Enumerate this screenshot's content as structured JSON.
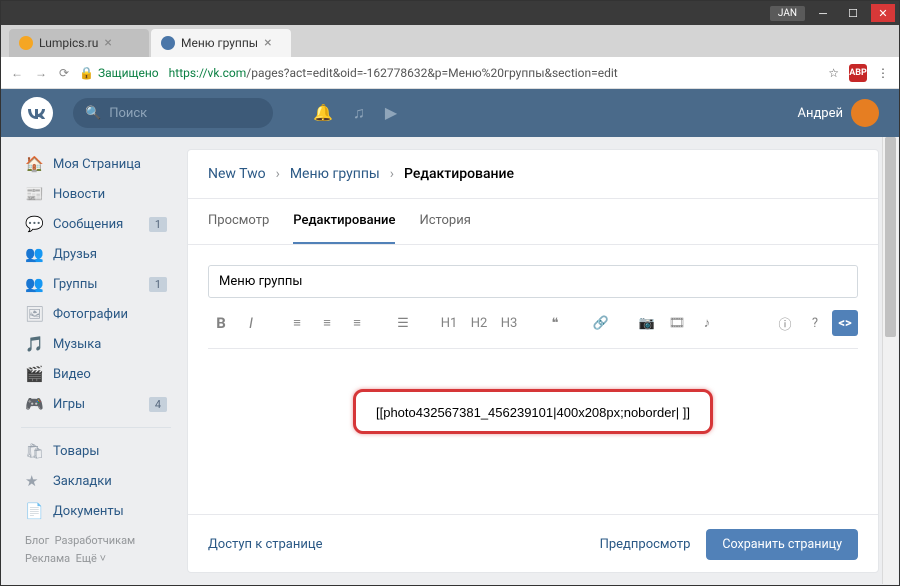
{
  "window": {
    "user": "JAN"
  },
  "tabs": [
    {
      "title": "Lumpics.ru"
    },
    {
      "title": "Меню группы"
    }
  ],
  "address": {
    "secure": "Защищено",
    "host": "https://vk.com",
    "path": "/pages?act=edit&oid=-162778632&p=Меню%20группы&section=edit"
  },
  "header": {
    "search_placeholder": "Поиск",
    "username": "Андрей"
  },
  "sidebar": {
    "items": [
      {
        "icon": "🏠",
        "label": "Моя Страница"
      },
      {
        "icon": "📰",
        "label": "Новости"
      },
      {
        "icon": "💬",
        "label": "Сообщения",
        "badge": "1"
      },
      {
        "icon": "👥",
        "label": "Друзья"
      },
      {
        "icon": "👥",
        "label": "Группы",
        "badge": "1"
      },
      {
        "icon": "🖼",
        "label": "Фотографии"
      },
      {
        "icon": "🎵",
        "label": "Музыка"
      },
      {
        "icon": "🎬",
        "label": "Видео"
      },
      {
        "icon": "🎮",
        "label": "Игры",
        "badge": "4"
      }
    ],
    "items2": [
      {
        "icon": "🛍",
        "label": "Товары"
      },
      {
        "icon": "★",
        "label": "Закладки"
      },
      {
        "icon": "📄",
        "label": "Документы"
      }
    ],
    "footer1": "Блог",
    "footer2": "Разработчикам",
    "footer3": "Реклама",
    "footer4": "Ещё ˅"
  },
  "breadcrumbs": {
    "a": "New Two",
    "b": "Меню группы",
    "c": "Редактирование"
  },
  "page_tabs": {
    "view": "Просмотр",
    "edit": "Редактирование",
    "hist": "История"
  },
  "title_input": "Меню группы",
  "toolbar": {
    "b": "B",
    "i": "I",
    "h1": "H1",
    "h2": "H2",
    "h3": "H3",
    "q": "❝",
    "info": "ⓘ",
    "help": "?",
    "code": "<>"
  },
  "editor_content": "[[photo432567381_456239101|400x208px;noborder| ]]",
  "footer": {
    "access": "Доступ к странице",
    "preview": "Предпросмотр",
    "save": "Сохранить страницу"
  }
}
